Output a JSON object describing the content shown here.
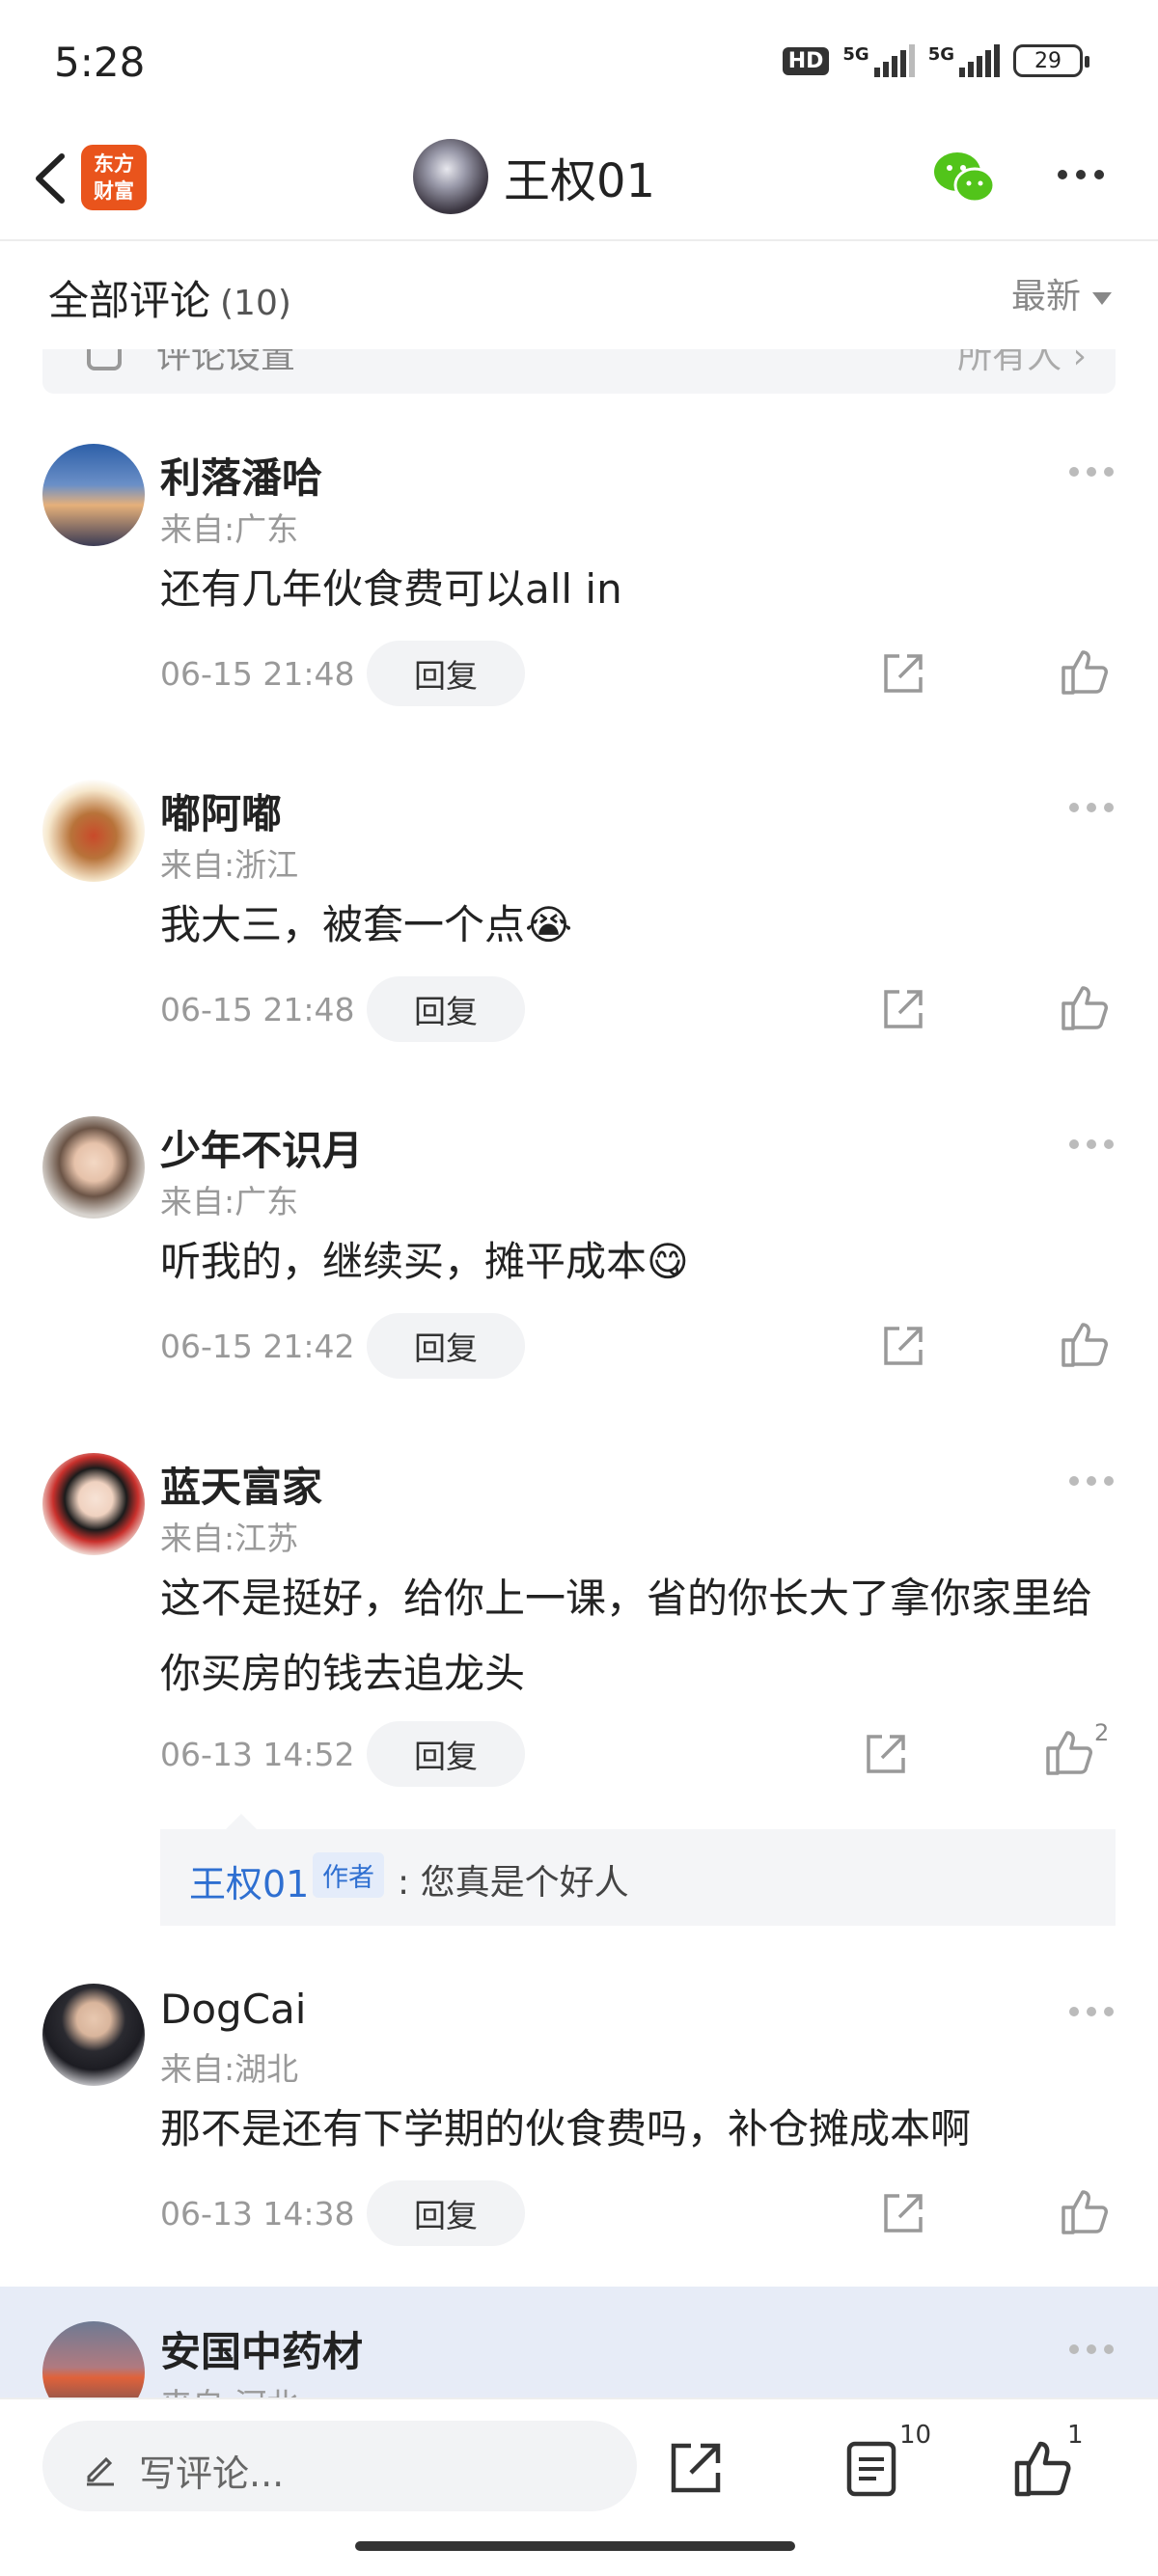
{
  "status_bar": {
    "time": "5:28",
    "hd": "HD",
    "net1": "5G",
    "net2": "5G",
    "battery": "29"
  },
  "header": {
    "logo_line1": "东方",
    "logo_line2": "财富",
    "title": "王权01"
  },
  "comments_section": {
    "title": "全部评论",
    "count": "(10)",
    "sort": "最新",
    "settings_label": "评论设置",
    "settings_right": "所有人 ›"
  },
  "comments": [
    {
      "name": "利落潘哈",
      "location": "来自:广东",
      "text": "还有几年伙食费可以all in",
      "date": "06-15 21:48",
      "reply_label": "回复",
      "likes": ""
    },
    {
      "name": "嘟阿嘟",
      "location": "来自:浙江",
      "text": "我大三，被套一个点😭",
      "date": "06-15 21:48",
      "reply_label": "回复",
      "likes": ""
    },
    {
      "name": "少年不识月",
      "location": "来自:广东",
      "text": "听我的，继续买，摊平成本😋",
      "date": "06-15 21:42",
      "reply_label": "回复",
      "likes": ""
    },
    {
      "name": "蓝天富家",
      "location": "来自:江苏",
      "text": "这不是挺好，给你上一课，省的你长大了拿你家里给你买房的钱去追龙头",
      "date": "06-13 14:52",
      "reply_label": "回复",
      "likes": "2"
    },
    {
      "name": "DogCai",
      "location": "来自:湖北",
      "text": "那不是还有下学期的伙食费吗，补仓摊成本啊",
      "date": "06-13 14:38",
      "reply_label": "回复",
      "likes": ""
    },
    {
      "name": "安国中药材",
      "location": "来自:河北"
    }
  ],
  "author_reply": {
    "name": "王权01",
    "tag": "作者",
    "text": ": 您真是个好人"
  },
  "bottom_bar": {
    "write_placeholder": "写评论...",
    "comment_count": "10",
    "like_count": "1"
  },
  "colors": {
    "accent_blue": "#2e6fd1",
    "logo_orange": "#e9541c",
    "highlight": "#e7ecf7"
  }
}
